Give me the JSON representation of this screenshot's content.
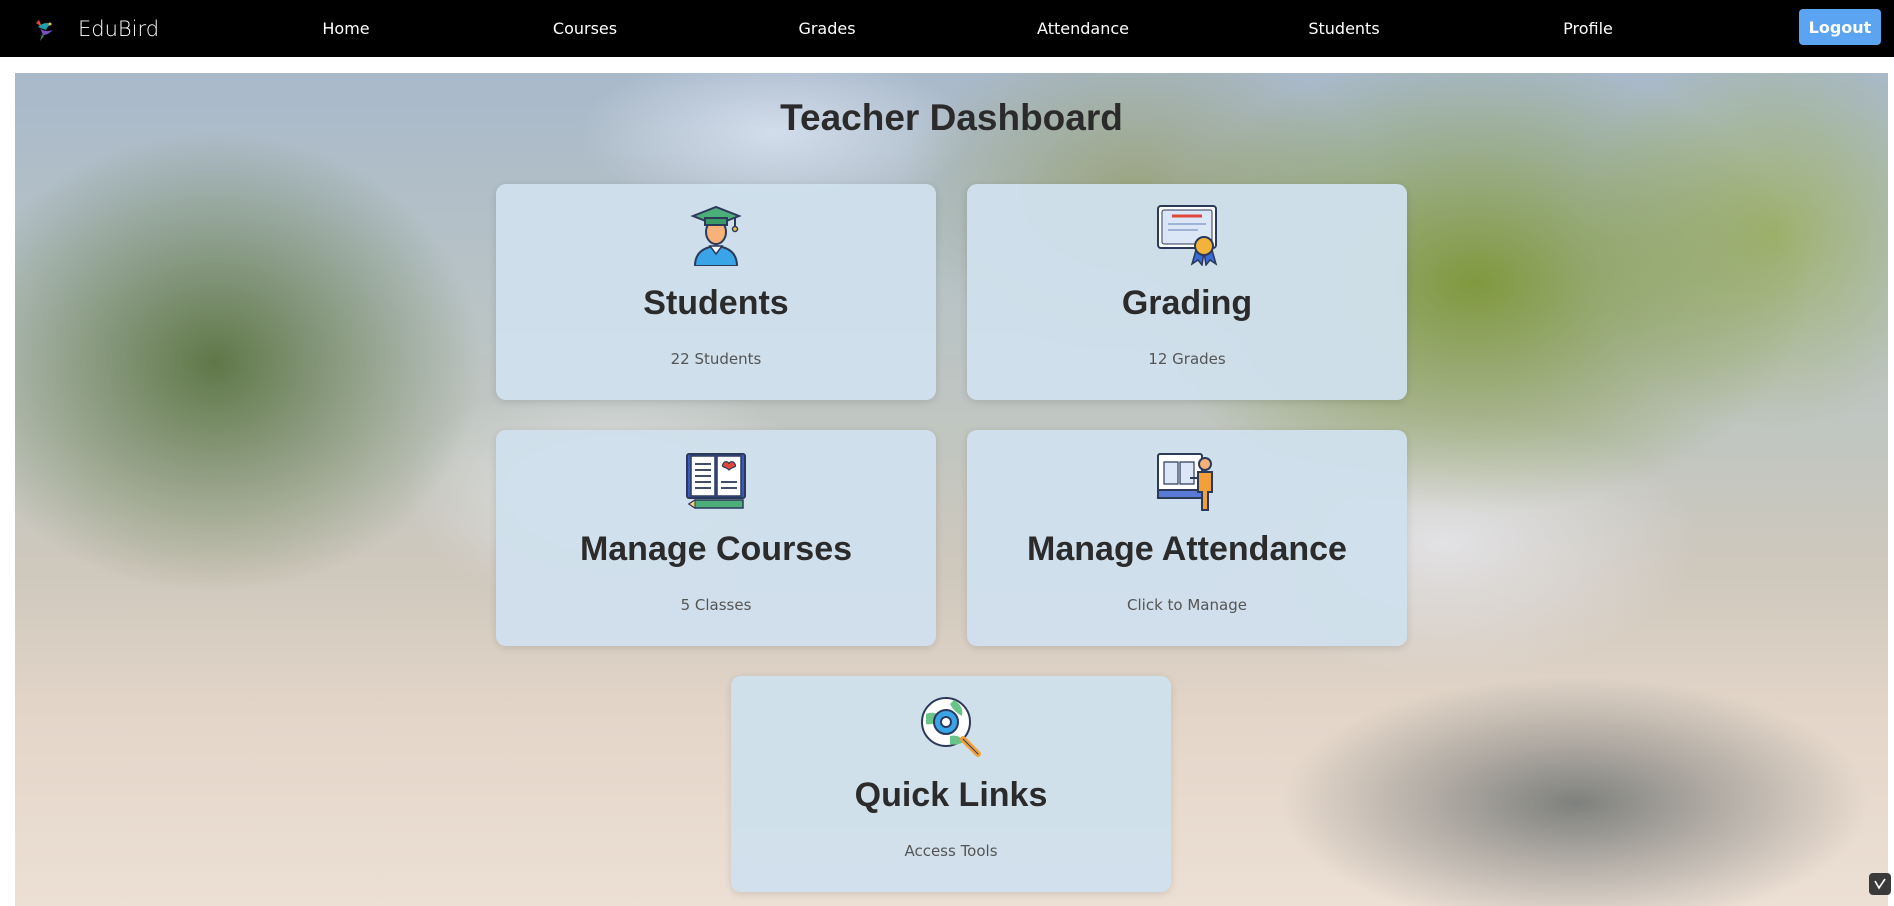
{
  "app": {
    "brand_name": "EduBird"
  },
  "nav": {
    "items": [
      {
        "label": "Home"
      },
      {
        "label": "Courses"
      },
      {
        "label": "Grades"
      },
      {
        "label": "Attendance"
      },
      {
        "label": "Students"
      },
      {
        "label": "Profile"
      }
    ],
    "logout_label": "Logout"
  },
  "main": {
    "title": "Teacher Dashboard",
    "cards": [
      {
        "icon": "graduate-student-icon",
        "title": "Students",
        "subtitle": "22 Students"
      },
      {
        "icon": "certificate-icon",
        "title": "Grading",
        "subtitle": "12 Grades"
      },
      {
        "icon": "open-book-icon",
        "title": "Manage Courses",
        "subtitle": "5 Classes"
      },
      {
        "icon": "teacher-board-icon",
        "title": "Manage Attendance",
        "subtitle": "Click to Manage"
      },
      {
        "icon": "gear-search-icon",
        "title": "Quick Links",
        "subtitle": "Access Tools"
      }
    ]
  },
  "colors": {
    "navbar_bg": "#000000",
    "logout_bg": "#5aa4f2",
    "card_bg": "#cfe0ec",
    "heading_text": "#2b2b2b"
  }
}
